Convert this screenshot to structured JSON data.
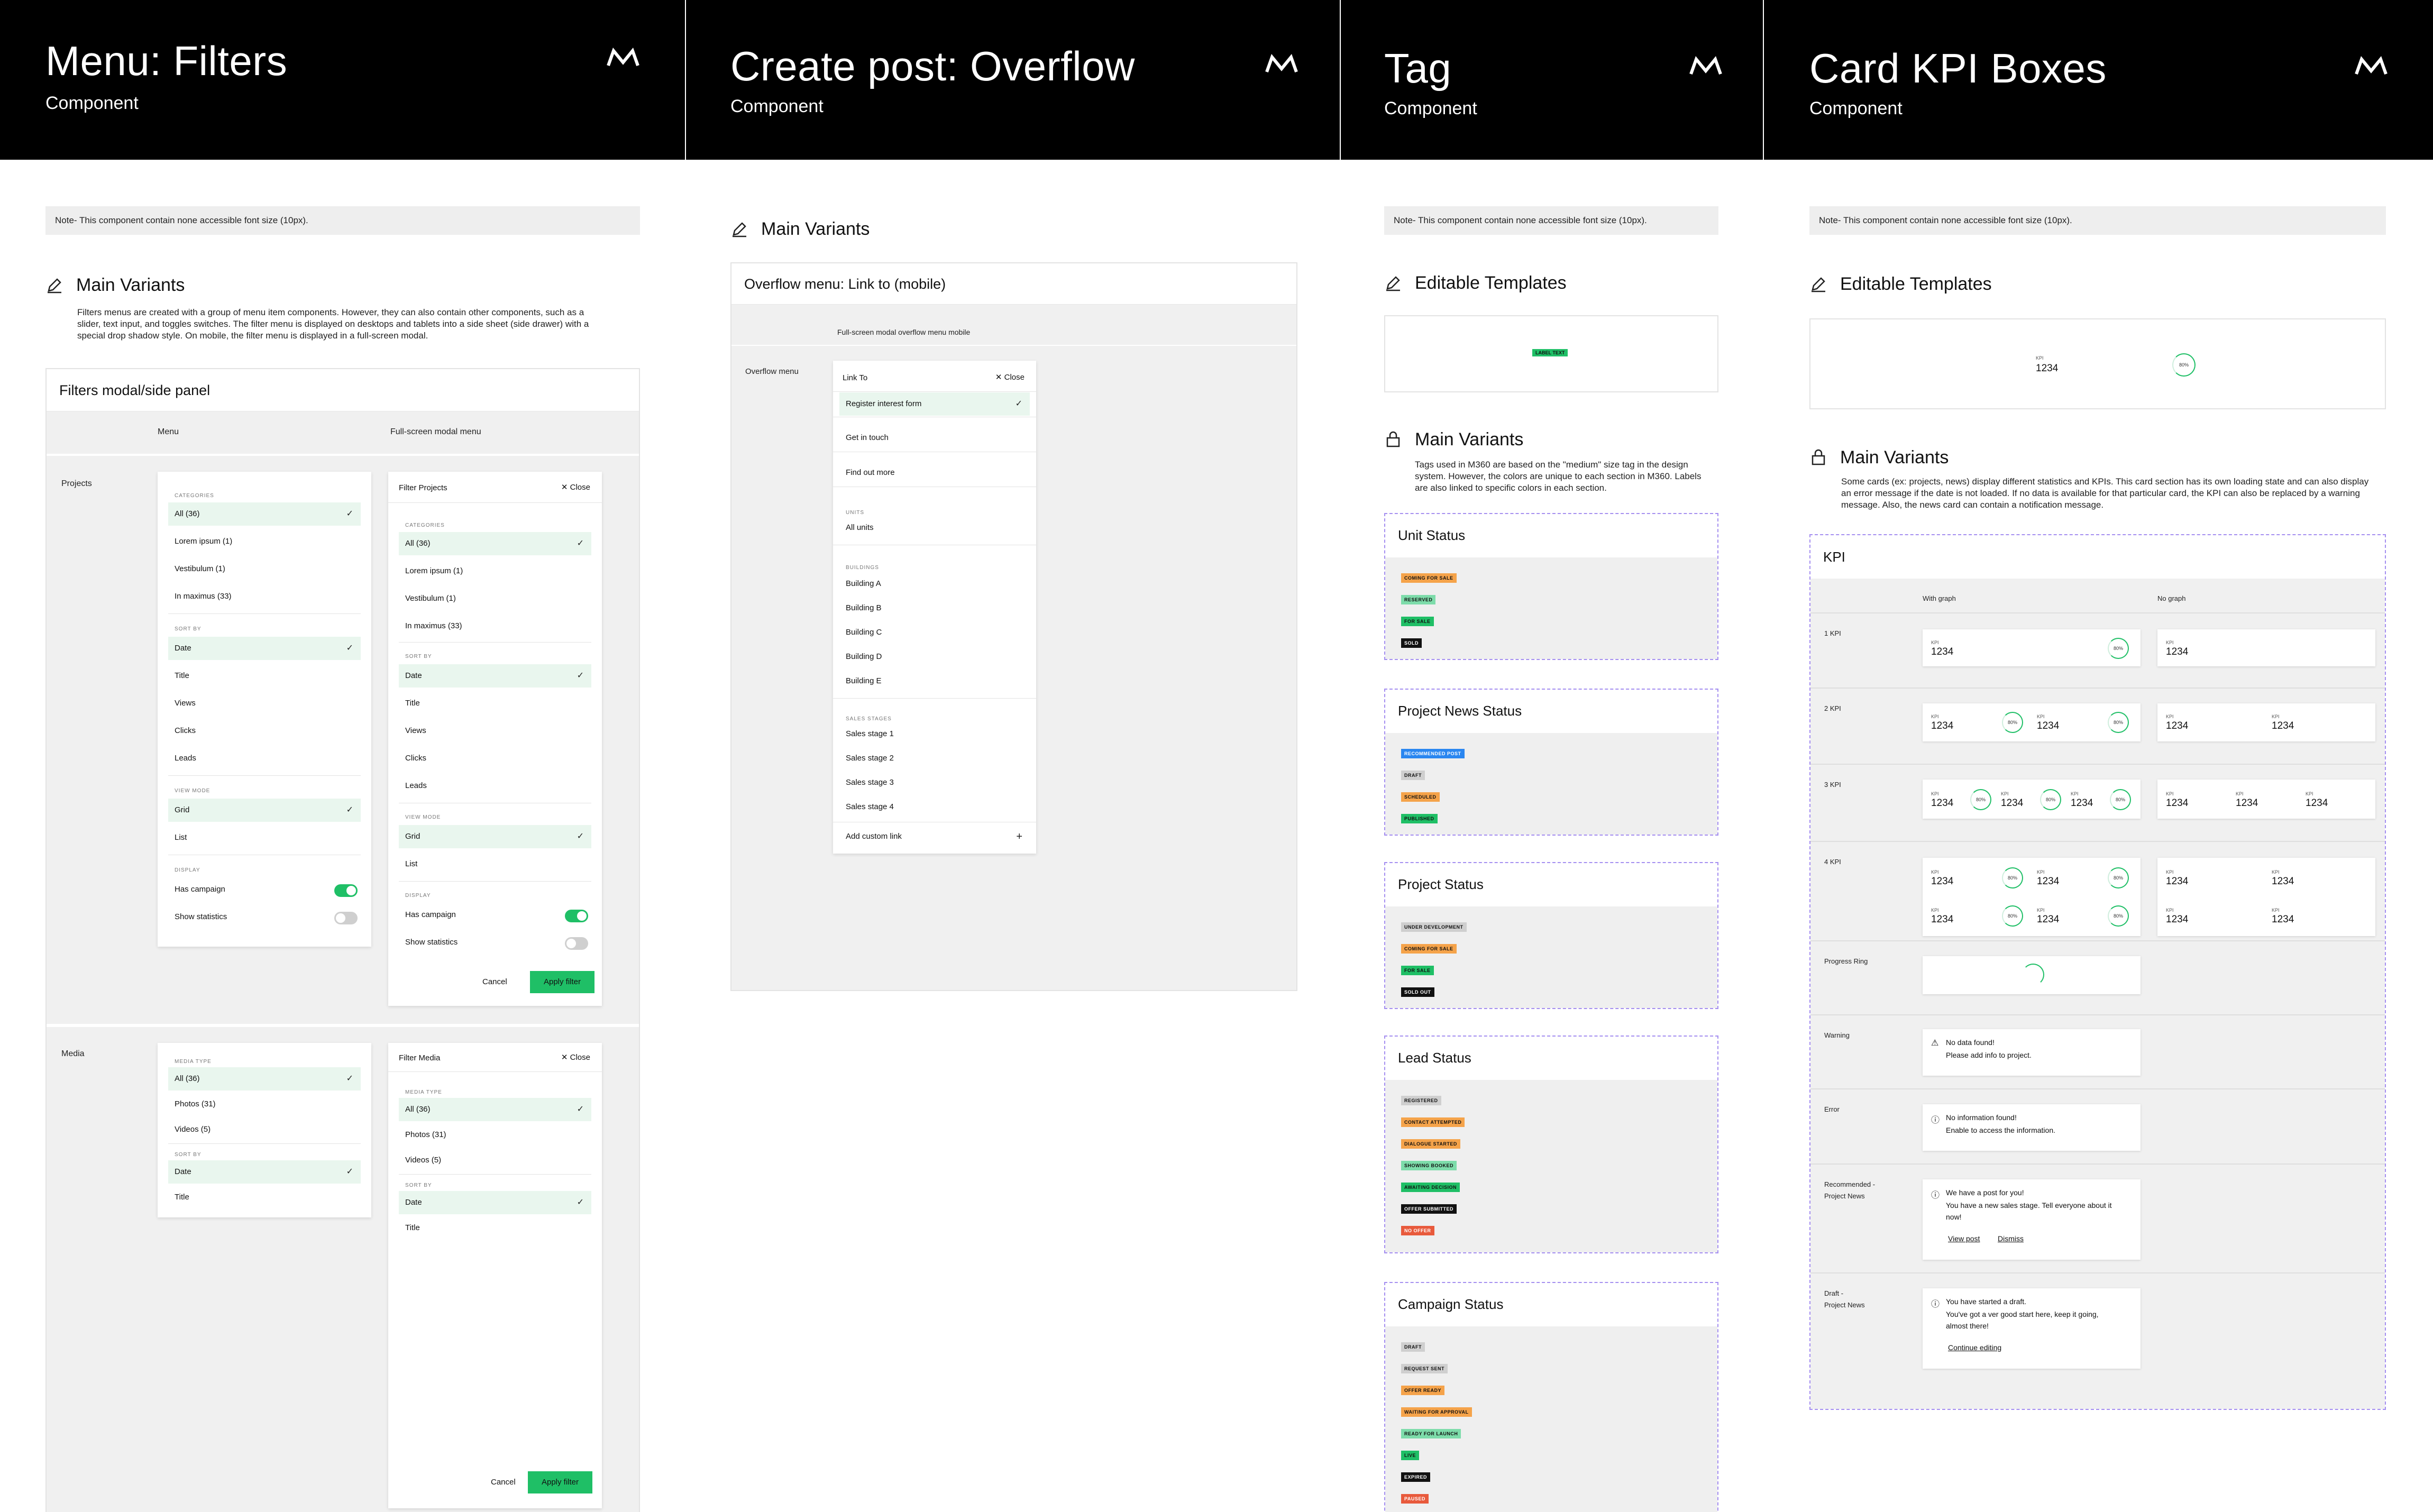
{
  "colors": {
    "accent": "#1fbf66",
    "header": "#000000",
    "orange": "#f5a34a",
    "red": "#e85a3c",
    "blue": "#2a86f0",
    "dark": "#111111",
    "grey_tag": "#cfcfcf",
    "green_light": "#7ddcaa"
  },
  "icons": {
    "logo": "brand-logo-icon",
    "edit": "pencil-icon",
    "lock": "lock-icon",
    "check": "check-icon",
    "close": "close-icon",
    "plus": "plus-icon",
    "info": "info-icon",
    "warning": "warning-icon"
  },
  "filters": {
    "title": "Menu: Filters",
    "subtitle": "Component",
    "note": "Note-  This component contain none accessible font size (10px).",
    "section": "Main Variants",
    "desc": [
      "Filters menus are created with a group of menu item components. However, they can also contain other components, such as a",
      "slider, text input, and toggles switches. The filter menu is displayed on desktops and tablets into a side sheet (side drawer) with a",
      "special drop shadow style. On mobile, the filter menu is displayed in a full-screen modal."
    ],
    "panel_title": "Filters modal/side panel",
    "col_menu": "Menu",
    "col_full": "Full-screen modal menu",
    "row_projects": "Projects",
    "row_media": "Media",
    "categories": "CATEGORIES",
    "sort_by": "SORT BY",
    "view_mode": "VIEW MODE",
    "display": "DISPLAY",
    "media_type": "MEDIA TYPE",
    "all": "All (36)",
    "lorem": "Lorem ipsum (1)",
    "vest": "Vestibulum (1)",
    "inmax": "In maximus (33)",
    "date": "Date",
    "title_opt": "Title",
    "views": "Views",
    "clicks": "Clicks",
    "leads": "Leads",
    "grid": "Grid",
    "list": "List",
    "has_campaign": "Has campaign",
    "show_stats": "Show statistics",
    "filter_projects": "Filter Projects",
    "filter_media": "Filter Media",
    "close": "Close",
    "cancel": "Cancel",
    "apply": "Apply filter",
    "photos": "Photos (31)",
    "videos": "Videos (5)"
  },
  "overflow": {
    "title": "Create post: Overflow",
    "subtitle": "Component",
    "section": "Main Variants",
    "panel_title": "Overflow menu: Link to (mobile)",
    "col": "Full-screen modal overflow menu mobile",
    "row": "Overflow menu",
    "link_to": "Link To",
    "close": "Close",
    "items": [
      "Register interest form",
      "Get in touch",
      "Find out more"
    ],
    "units": "UNITS",
    "all_units": "All units",
    "buildings": "BUILDINGS",
    "building_items": [
      "Building A",
      "Building B",
      "Building C",
      "Building D",
      "Building E"
    ],
    "sales": "SALES STAGES",
    "sales_items": [
      "Sales stage 1",
      "Sales stage 2",
      "Sales stage 3",
      "Sales stage 4"
    ],
    "add_custom": "Add custom link"
  },
  "tag": {
    "title": "Tag",
    "subtitle": "Component",
    "note": "Note-  This component contain none accessible font size (10px).",
    "editable": "Editable Templates",
    "label_text": "LABEL TEXT",
    "section": "Main Variants",
    "desc": [
      "Tags used in M360 are based on the \"medium\" size tag in the design",
      "system. However, the colors are unique to each section in M360. Labels",
      "are also linked to specific colors in each section."
    ],
    "groups": [
      {
        "name": "Unit Status",
        "tags": [
          {
            "t": "COMING FOR SALE",
            "c": "#f5a34a",
            "f": "#111"
          },
          {
            "t": "RESERVED",
            "c": "#7ddcaa",
            "f": "#111"
          },
          {
            "t": "FOR SALE",
            "c": "#1fbf66",
            "f": "#111"
          },
          {
            "t": "SOLD",
            "c": "#111111",
            "f": "#fff"
          }
        ]
      },
      {
        "name": "Project News Status",
        "tags": [
          {
            "t": "RECOMMENDED POST",
            "c": "#2a86f0",
            "f": "#fff"
          },
          {
            "t": "DRAFT",
            "c": "#cfcfcf",
            "f": "#111"
          },
          {
            "t": "SCHEDULED",
            "c": "#f5a34a",
            "f": "#111"
          },
          {
            "t": "PUBLISHED",
            "c": "#1fbf66",
            "f": "#111"
          }
        ]
      },
      {
        "name": "Project Status",
        "tags": [
          {
            "t": "UNDER DEVELOPMENT",
            "c": "#cfcfcf",
            "f": "#111"
          },
          {
            "t": "COMING FOR SALE",
            "c": "#f5a34a",
            "f": "#111"
          },
          {
            "t": "FOR SALE",
            "c": "#1fbf66",
            "f": "#111"
          },
          {
            "t": "SOLD OUT",
            "c": "#111111",
            "f": "#fff"
          }
        ]
      },
      {
        "name": "Lead Status",
        "tags": [
          {
            "t": "REGISTERED",
            "c": "#cfcfcf",
            "f": "#111"
          },
          {
            "t": "CONTACT ATTEMPTED",
            "c": "#f5a34a",
            "f": "#111"
          },
          {
            "t": "DIALOGUE STARTED",
            "c": "#f5a34a",
            "f": "#111"
          },
          {
            "t": "SHOWING BOOKED",
            "c": "#7ddcaa",
            "f": "#111"
          },
          {
            "t": "AWAITING DECISION",
            "c": "#1fbf66",
            "f": "#111"
          },
          {
            "t": "OFFER SUBMITTED",
            "c": "#111111",
            "f": "#fff"
          },
          {
            "t": "NO OFFER",
            "c": "#e85a3c",
            "f": "#fff"
          }
        ]
      },
      {
        "name": "Campaign Status",
        "tags": [
          {
            "t": "DRAFT",
            "c": "#cfcfcf",
            "f": "#111"
          },
          {
            "t": "REQUEST SENT",
            "c": "#cfcfcf",
            "f": "#111"
          },
          {
            "t": "OFFER READY",
            "c": "#f5a34a",
            "f": "#111"
          },
          {
            "t": "WAITING FOR APPROVAL",
            "c": "#f5a34a",
            "f": "#111"
          },
          {
            "t": "READY FOR LAUNCH",
            "c": "#7ddcaa",
            "f": "#111"
          },
          {
            "t": "LIVE",
            "c": "#1fbf66",
            "f": "#111"
          },
          {
            "t": "EXPIRED",
            "c": "#111111",
            "f": "#fff"
          },
          {
            "t": "PAUSED",
            "c": "#e85a3c",
            "f": "#fff"
          }
        ]
      }
    ]
  },
  "kpi": {
    "title": "Card KPI Boxes",
    "subtitle": "Component",
    "note": "Note-  This component contain none accessible font size (10px).",
    "editable": "Editable Templates",
    "kpi": "KPI",
    "value": "1234",
    "pct": "80%",
    "section": "Main Variants",
    "desc": [
      "Some cards (ex: projects, news) display different statistics and KPIs. This card section has its own loading state and can also display",
      "an error message if the date is not loaded. If no data is available for that particular card, the KPI can also be replaced by a warning",
      "message. Also, the news card can contain a notification message."
    ],
    "panel_title": "KPI",
    "with_graph": "With graph",
    "no_graph": "No graph",
    "rows": [
      "1 KPI",
      "2 KPI",
      "3 KPI",
      "4 KPI",
      "Progress Ring",
      "Warning",
      "Error"
    ],
    "rec_label": [
      "Recommended -",
      "Project News"
    ],
    "draft_label": [
      "Draft -",
      "Project News"
    ],
    "warning_l1": "No data found!",
    "warning_l2": "Please add info to project.",
    "error_l1": "No information found!",
    "error_l2": "Enable to access the information.",
    "rec_l1": "We have a post for you!",
    "rec_l2": "You have a new sales stage. Tell everyone about it",
    "rec_l3": "now!",
    "view_post": "View post",
    "dismiss": "Dismiss",
    "draft_l1": "You have started a draft.",
    "draft_l2": "You've got a ver good start here, keep it going,",
    "draft_l3": "almost there!",
    "continue": "Continue editing"
  }
}
